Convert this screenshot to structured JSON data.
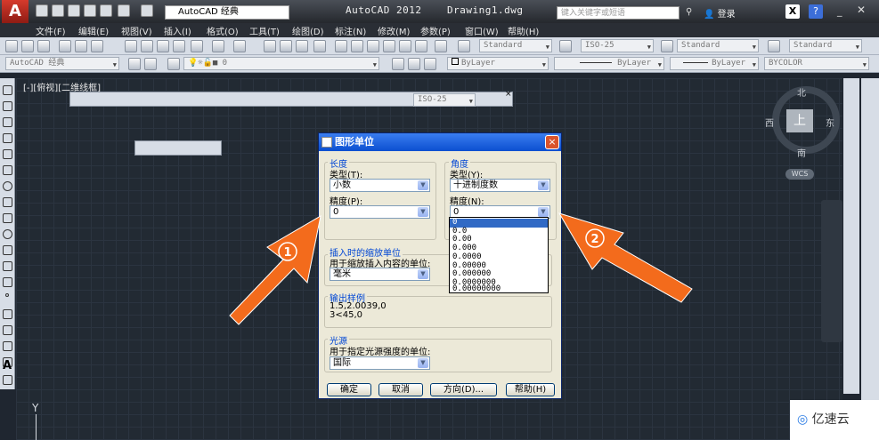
{
  "app": {
    "title": "AutoCAD 2012",
    "document": "Drawing1.dwg",
    "logo": "A",
    "workspace": "AutoCAD 经典",
    "search_placeholder": "键入关键字或短语",
    "login": "登录"
  },
  "menu": [
    "文件(F)",
    "编辑(E)",
    "视图(V)",
    "插入(I)",
    "格式(O)",
    "工具(T)",
    "绘图(D)",
    "标注(N)",
    "修改(M)",
    "参数(P)",
    "窗口(W)",
    "帮助(H)"
  ],
  "toolbar1": {
    "text_style": "Standard",
    "dim_style": "ISO-25",
    "table_style": "Standard",
    "mleader_style": "Standard"
  },
  "toolbar2": {
    "workspace": "AutoCAD 经典",
    "layer": "0",
    "color": "ByLayer",
    "linetype": "ByLayer",
    "lineweight": "ByLayer",
    "plotstyle": "BYCOLOR"
  },
  "viewport_label": "[-][俯视][二维线框]",
  "float_toolbar_select": "ISO-25",
  "viewcube": {
    "top": "上",
    "north": "北",
    "south": "南",
    "east": "东",
    "west": "西",
    "wcs": "WCS"
  },
  "ucs_label": "Y",
  "dialog": {
    "title": "图形单位",
    "close": "×",
    "length": {
      "group": "长度",
      "type_label": "类型(T):",
      "type_value": "小数",
      "precision_label": "精度(P):",
      "precision_value": "0"
    },
    "angle": {
      "group": "角度",
      "type_label": "类型(Y):",
      "type_value": "十进制度数",
      "precision_label": "精度(N):",
      "precision_value": "0",
      "precision_options": [
        "0",
        "0.0",
        "0.00",
        "0.000",
        "0.0000",
        "0.00000",
        "0.000000",
        "0.0000000",
        "0.00000000"
      ]
    },
    "insertion": {
      "group": "插入时的缩放单位",
      "label": "用于缩放插入内容的单位:",
      "value": "毫米"
    },
    "sample": {
      "group": "输出样例",
      "line1": "1.5,2.0039,0",
      "line2": "3<45,0"
    },
    "lighting": {
      "group": "光源",
      "label": "用于指定光源强度的单位:",
      "value": "国际"
    },
    "buttons": {
      "ok": "确定",
      "cancel": "取消",
      "direction": "方向(D)...",
      "help": "帮助(H)"
    }
  },
  "annotations": {
    "arrow1": "1",
    "arrow2": "2"
  },
  "watermark": "亿速云",
  "colors": {
    "arrow": "#f36b1c",
    "dialog_title": "#0b4fd0",
    "selection": "#316ac5"
  }
}
